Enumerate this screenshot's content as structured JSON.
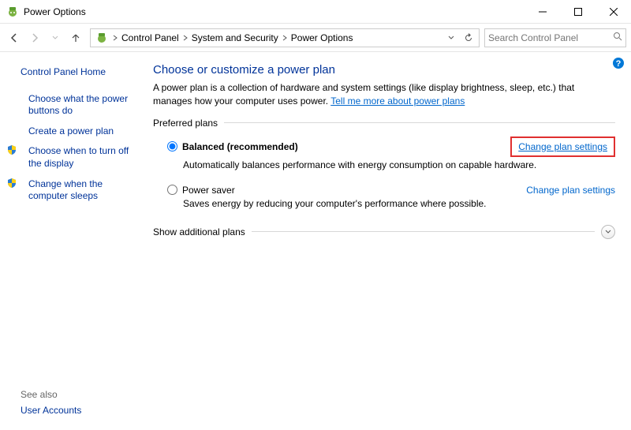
{
  "titlebar": {
    "title": "Power Options"
  },
  "breadcrumb": {
    "items": [
      "Control Panel",
      "System and Security",
      "Power Options"
    ]
  },
  "search": {
    "placeholder": "Search Control Panel"
  },
  "sidebar": {
    "home": "Control Panel Home",
    "items": [
      {
        "label": "Choose what the power buttons do",
        "shield": false
      },
      {
        "label": "Create a power plan",
        "shield": false
      },
      {
        "label": "Choose when to turn off the display",
        "shield": true
      },
      {
        "label": "Change when the computer sleeps",
        "shield": true
      }
    ],
    "see_also_label": "See also",
    "see_also_items": [
      "User Accounts"
    ]
  },
  "main": {
    "heading": "Choose or customize a power plan",
    "description": "A power plan is a collection of hardware and system settings (like display brightness, sleep, etc.) that manages how your computer uses power. ",
    "description_link": "Tell me more about power plans",
    "preferred_label": "Preferred plans",
    "plans": [
      {
        "name": "Balanced (recommended)",
        "desc": "Automatically balances performance with energy consumption on capable hardware.",
        "change_link": "Change plan settings",
        "selected": true,
        "highlighted": true
      },
      {
        "name": "Power saver",
        "desc": "Saves energy by reducing your computer's performance where possible.",
        "change_link": "Change plan settings",
        "selected": false,
        "highlighted": false
      }
    ],
    "show_additional": "Show additional plans"
  }
}
